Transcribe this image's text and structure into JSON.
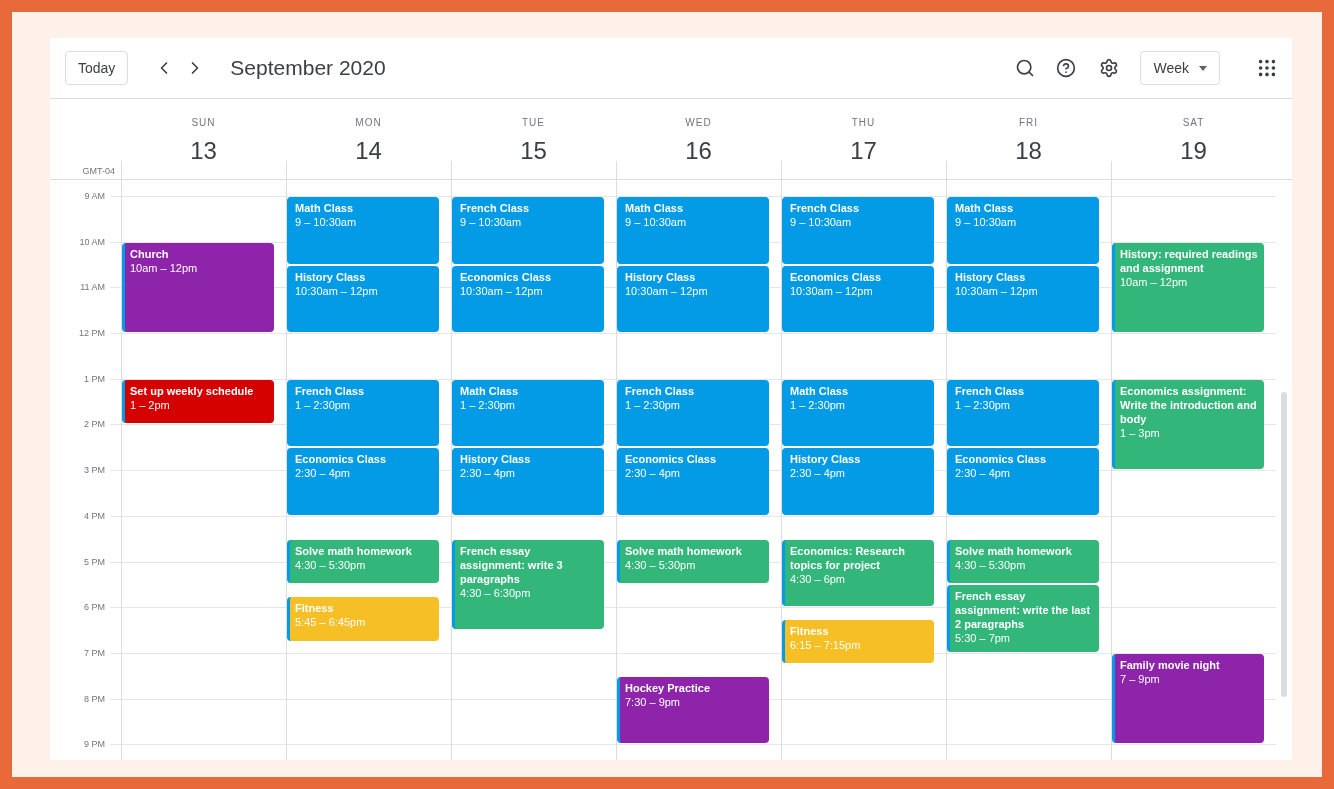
{
  "toolbar": {
    "today_button": "Today",
    "title": "September 2020",
    "view_dropdown": "Week"
  },
  "timezone": "GMT-04",
  "hours": [
    "9 AM",
    "10 AM",
    "11 AM",
    "12 PM",
    "1 PM",
    "2 PM",
    "3 PM",
    "4 PM",
    "5 PM",
    "6 PM",
    "7 PM",
    "8 PM",
    "9 PM"
  ],
  "days": [
    {
      "dow": "SUN",
      "date": "13",
      "events": [
        {
          "title": "Church",
          "time": "10am – 12pm",
          "color": "#8e24aa"
        },
        {
          "title": "Set up weekly schedule",
          "time": "1 – 2pm",
          "color": "#d50000"
        }
      ]
    },
    {
      "dow": "MON",
      "date": "14",
      "events": [
        {
          "title": "Math Class",
          "time": "9 – 10:30am",
          "color": "#039be5"
        },
        {
          "title": "History Class",
          "time": "10:30am – 12pm",
          "color": "#039be5"
        },
        {
          "title": "French Class",
          "time": "1 – 2:30pm",
          "color": "#039be5"
        },
        {
          "title": "Economics Class",
          "time": "2:30 – 4pm",
          "color": "#039be5"
        },
        {
          "title": "Solve math homework",
          "time": "4:30 – 5:30pm",
          "color": "#33b679"
        },
        {
          "title": "Fitness",
          "time": "5:45 – 6:45pm",
          "color": "#f6bf26"
        }
      ]
    },
    {
      "dow": "TUE",
      "date": "15",
      "events": [
        {
          "title": "French Class",
          "time": "9 – 10:30am",
          "color": "#039be5"
        },
        {
          "title": "Economics Class",
          "time": "10:30am – 12pm",
          "color": "#039be5"
        },
        {
          "title": "Math Class",
          "time": "1 – 2:30pm",
          "color": "#039be5"
        },
        {
          "title": "History Class",
          "time": "2:30 – 4pm",
          "color": "#039be5"
        },
        {
          "title": "French essay assignment: write 3 paragraphs",
          "time": "4:30 – 6:30pm",
          "color": "#33b679"
        }
      ]
    },
    {
      "dow": "WED",
      "date": "16",
      "events": [
        {
          "title": "Math Class",
          "time": "9 – 10:30am",
          "color": "#039be5"
        },
        {
          "title": "History Class",
          "time": "10:30am – 12pm",
          "color": "#039be5"
        },
        {
          "title": "French Class",
          "time": "1 – 2:30pm",
          "color": "#039be5"
        },
        {
          "title": "Economics Class",
          "time": "2:30 – 4pm",
          "color": "#039be5"
        },
        {
          "title": "Solve math homework",
          "time": "4:30 – 5:30pm",
          "color": "#33b679"
        },
        {
          "title": "Hockey Practice",
          "time": "7:30 – 9pm",
          "color": "#8e24aa"
        }
      ]
    },
    {
      "dow": "THU",
      "date": "17",
      "events": [
        {
          "title": "French Class",
          "time": "9 – 10:30am",
          "color": "#039be5"
        },
        {
          "title": "Economics Class",
          "time": "10:30am – 12pm",
          "color": "#039be5"
        },
        {
          "title": "Math Class",
          "time": "1 – 2:30pm",
          "color": "#039be5"
        },
        {
          "title": "History Class",
          "time": "2:30 – 4pm",
          "color": "#039be5"
        },
        {
          "title": "Economics: Research topics for project",
          "time": "4:30 – 6pm",
          "color": "#33b679"
        },
        {
          "title": "Fitness",
          "time": "6:15 – 7:15pm",
          "color": "#f6bf26"
        }
      ]
    },
    {
      "dow": "FRI",
      "date": "18",
      "events": [
        {
          "title": "Math Class",
          "time": "9 – 10:30am",
          "color": "#039be5"
        },
        {
          "title": "History Class",
          "time": "10:30am – 12pm",
          "color": "#039be5"
        },
        {
          "title": "French Class",
          "time": "1 – 2:30pm",
          "color": "#039be5"
        },
        {
          "title": "Economics Class",
          "time": "2:30 – 4pm",
          "color": "#039be5"
        },
        {
          "title": "Solve math homework",
          "time": "4:30 – 5:30pm",
          "color": "#33b679"
        },
        {
          "title": "French essay assignment: write the last 2 paragraphs",
          "time": "5:30 – 7pm",
          "color": "#33b679"
        }
      ]
    },
    {
      "dow": "SAT",
      "date": "19",
      "events": [
        {
          "title": "History: required readings and assignment",
          "time": "10am – 12pm",
          "color": "#33b679"
        },
        {
          "title": "Economics assignment: Write the introduction and body",
          "time": "1 – 3pm",
          "color": "#33b679"
        },
        {
          "title": "Family movie night",
          "time": "7 – 9pm",
          "color": "#8e24aa"
        }
      ]
    }
  ]
}
